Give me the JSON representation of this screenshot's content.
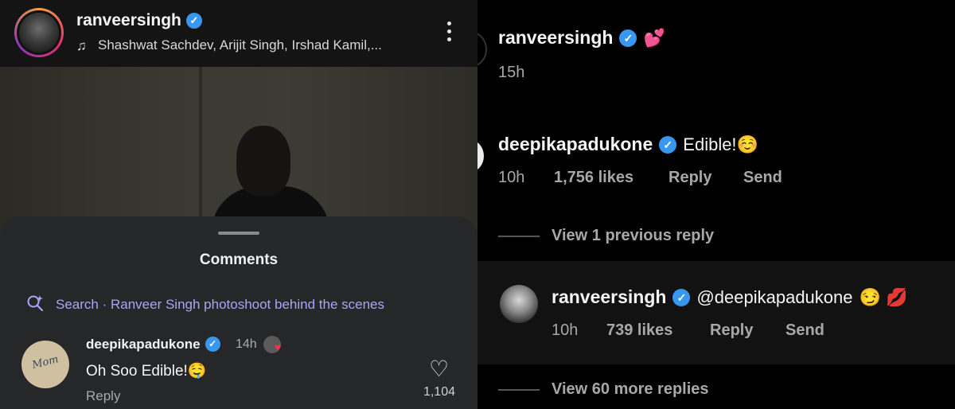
{
  "left": {
    "header": {
      "username": "ranveersingh",
      "audio": "Shashwat Sachdev, Arijit Singh, Irshad Kamil,..."
    },
    "sheet": {
      "title": "Comments",
      "search_text": "Search · Ranveer Singh photoshoot behind the scenes",
      "comment": {
        "username": "deepikapadukone",
        "time": "14h",
        "avatar_text": "Mom",
        "text": "Oh Soo Edible!🤤",
        "reply_label": "Reply",
        "like_count": "1,104"
      }
    }
  },
  "right": {
    "post": {
      "username": "ranveersingh",
      "emoji": "💕",
      "time": "15h"
    },
    "comment1": {
      "username": "deepikapadukone",
      "text": "Edible!☺️",
      "time": "10h",
      "likes": "1,756 likes",
      "reply": "Reply",
      "send": "Send"
    },
    "view_previous": "View 1 previous reply",
    "reply1": {
      "username": "ranveersingh",
      "text": "@deepikapadukone",
      "emoji": "😏 💋",
      "time": "10h",
      "likes": "739 likes",
      "reply": "Reply",
      "send": "Send"
    },
    "view_more": "View 60 more replies"
  },
  "colors": {
    "verified": "#3897f0",
    "search_accent": "#a8a6f5",
    "like_red": "#ff3040"
  }
}
